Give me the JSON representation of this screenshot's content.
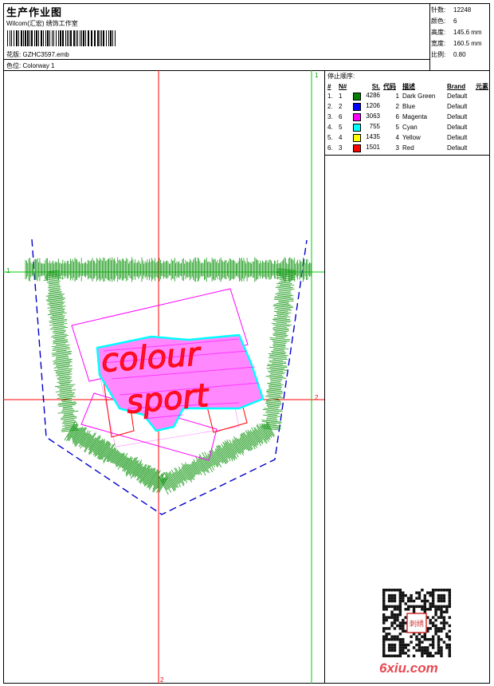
{
  "header": {
    "title": "生产作业图",
    "subtitle": "Wilcom(汇宏) 绣饰工作室",
    "design_label": "花版:",
    "design_value": "GZHC3597.emb",
    "colorway_label": "色位:",
    "colorway_value": "Colorway 1"
  },
  "stats": {
    "stitches_label": "针数:",
    "stitches_value": "12248",
    "colors_label": "颜色:",
    "colors_value": "6",
    "height_label": "高度:",
    "height_value": "145.6 mm",
    "width_label": "宽度:",
    "width_value": "160.5 mm",
    "scale_label": "比例:",
    "scale_value": "0.80"
  },
  "sequence": {
    "title": "停止顺序:",
    "headers": [
      "#",
      "N#",
      "St.",
      "代码",
      "描述",
      "Brand",
      "元素"
    ],
    "rows": [
      {
        "idx": "1.",
        "n": "1",
        "color": "#008000",
        "st": "4286",
        "code": "1",
        "desc": "Dark Green",
        "brand": "Default"
      },
      {
        "idx": "2.",
        "n": "2",
        "color": "#0000ff",
        "st": "1206",
        "code": "2",
        "desc": "Blue",
        "brand": "Default"
      },
      {
        "idx": "3.",
        "n": "6",
        "color": "#ff00ff",
        "st": "3063",
        "code": "6",
        "desc": "Magenta",
        "brand": "Default"
      },
      {
        "idx": "4.",
        "n": "5",
        "color": "#00ffff",
        "st": "755",
        "code": "5",
        "desc": "Cyan",
        "brand": "Default"
      },
      {
        "idx": "5.",
        "n": "4",
        "color": "#ffff00",
        "st": "1435",
        "code": "4",
        "desc": "Yellow",
        "brand": "Default"
      },
      {
        "idx": "6.",
        "n": "3",
        "color": "#ff0000",
        "st": "1501",
        "code": "3",
        "desc": "Red",
        "brand": "Default"
      }
    ]
  },
  "guides": {
    "h1": "1",
    "v1": "1",
    "h2": "2",
    "v2": "2"
  },
  "design_text": {
    "line1": "colour",
    "line2": "sport"
  },
  "watermark": "6xiu.com",
  "qr_stamp": "刺绣"
}
